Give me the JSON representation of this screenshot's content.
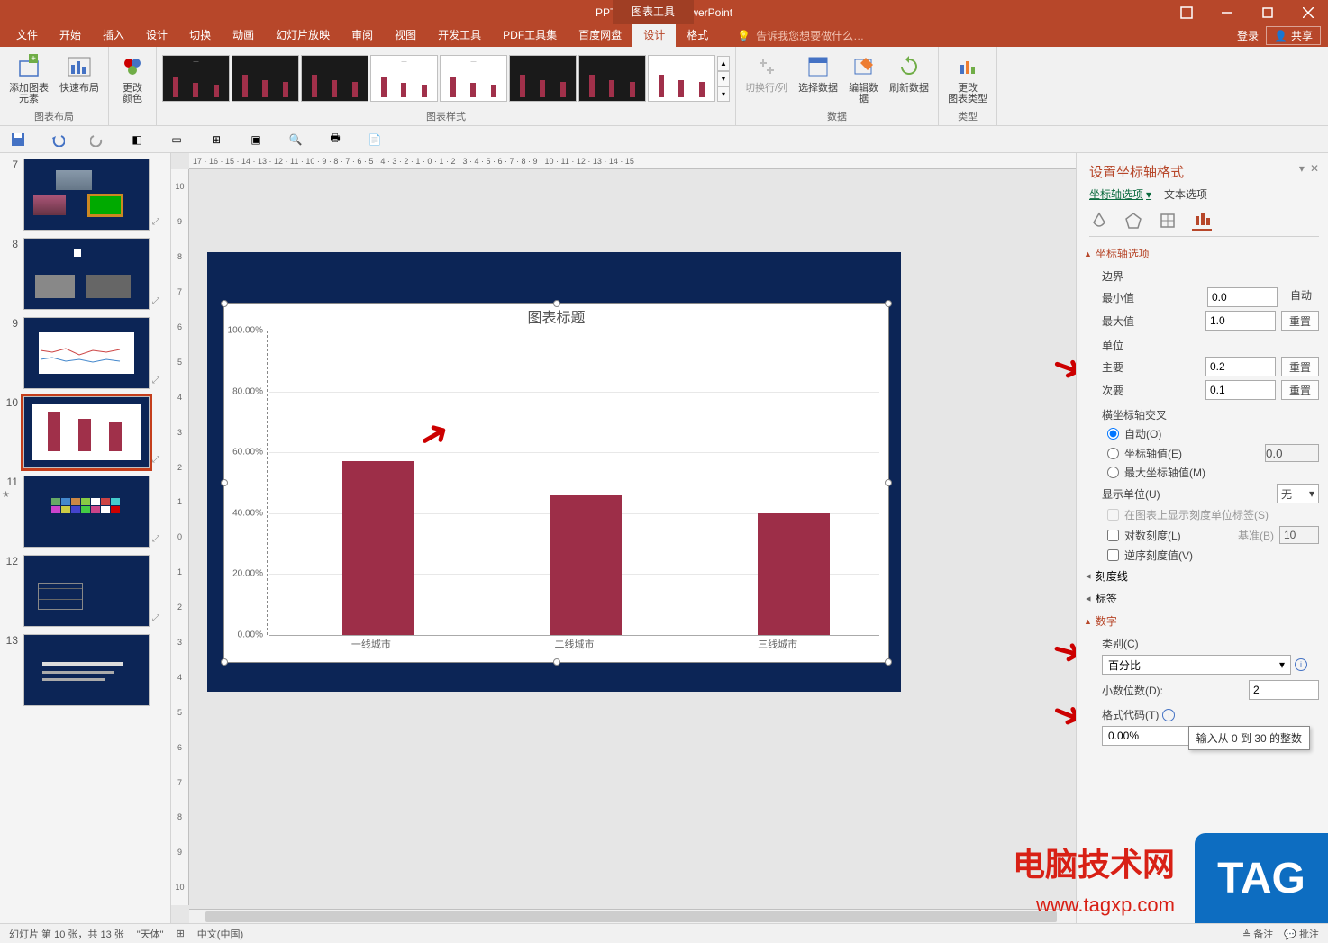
{
  "titlebar": {
    "filename": "PPT教程2.pptx - PowerPoint",
    "tool_tab": "图表工具"
  },
  "menu": {
    "items": [
      "文件",
      "开始",
      "插入",
      "设计",
      "切换",
      "动画",
      "幻灯片放映",
      "审阅",
      "视图",
      "开发工具",
      "PDF工具集",
      "百度网盘",
      "设计",
      "格式"
    ],
    "active_index": 12,
    "tell_me_placeholder": "告诉我您想要做什么…",
    "login": "登录",
    "share": "共享"
  },
  "ribbon": {
    "group1": {
      "btn1": "添加图表\n元素",
      "btn2": "快速布局",
      "label": "图表布局"
    },
    "group2": {
      "btn1": "更改\n颜色"
    },
    "group_styles": {
      "label": "图表样式"
    },
    "group_data": {
      "btn1": "切换行/列",
      "btn2": "选择数据",
      "btn3": "编辑数\n据",
      "btn4": "刷新数据",
      "label": "数据"
    },
    "group_type": {
      "btn1": "更改\n图表类型",
      "label": "类型"
    }
  },
  "ruler_h": "17 · 16 · 15 · 14 · 13 · 12 · 11 · 10 · 9 · 8 · 7 · 6 · 5 · 4 · 3 · 2 · 1 · 0 · 1 · 2 · 3 · 4 · 5 · 6 · 7 · 8 · 9 · 10 · 11 · 12 · 13 · 14 · 15",
  "ruler_v": [
    "10",
    "9",
    "8",
    "7",
    "6",
    "5",
    "4",
    "3",
    "2",
    "1",
    "0",
    "1",
    "2",
    "3",
    "4",
    "5",
    "6",
    "7",
    "8",
    "9",
    "10"
  ],
  "slides": {
    "visible_numbers": [
      7,
      8,
      9,
      10,
      11,
      12,
      13
    ],
    "active": 10
  },
  "chart_data": {
    "type": "bar",
    "title": "图表标题",
    "categories": [
      "一线城市",
      "二线城市",
      "三线城市"
    ],
    "values": [
      0.57,
      0.46,
      0.4
    ],
    "y_ticks": [
      "100.00%",
      "80.00%",
      "60.00%",
      "40.00%",
      "20.00%",
      "0.00%"
    ],
    "ylim": [
      0,
      1
    ],
    "ylabel": "",
    "xlabel": ""
  },
  "format_pane": {
    "title": "设置坐标轴格式",
    "subtabs": {
      "axis": "坐标轴选项",
      "text": "文本选项"
    },
    "sections": {
      "axis_options": "坐标轴选项",
      "bounds": "边界",
      "min_label": "最小值",
      "min_val": "0.0",
      "auto": "自动",
      "max_label": "最大值",
      "max_val": "1.0",
      "reset": "重置",
      "units": "单位",
      "major_label": "主要",
      "major_val": "0.2",
      "minor_label": "次要",
      "minor_val": "0.1",
      "cross": "横坐标轴交叉",
      "cross_auto": "自动(O)",
      "cross_val_label": "坐标轴值(E)",
      "cross_val": "0.0",
      "cross_max": "最大坐标轴值(M)",
      "display_unit": "显示单位(U)",
      "display_unit_val": "无",
      "show_unit_label": "在图表上显示刻度单位标签(S)",
      "log_scale": "对数刻度(L)",
      "log_base_label": "基准(B)",
      "log_base": "10",
      "reverse": "逆序刻度值(V)",
      "ticks": "刻度线",
      "labels": "标签",
      "number": "数字",
      "category_label": "类别(C)",
      "category_val": "百分比",
      "decimals_label": "小数位数(D):",
      "decimals_val": "2",
      "format_code_label": "格式代码(T)",
      "format_code_val": "0.00%",
      "tooltip": "输入从 0 到 30 的整数"
    }
  },
  "statusbar": {
    "slide_info": "幻灯片 第 10 张，共 13 张",
    "theme": "\"天体\"",
    "lang": "中文(中国)",
    "notes": "备注",
    "comments": "批注"
  },
  "watermarks": {
    "w1": "电脑技术网",
    "w2": "www.tagxp.com",
    "tag": "TAG"
  }
}
